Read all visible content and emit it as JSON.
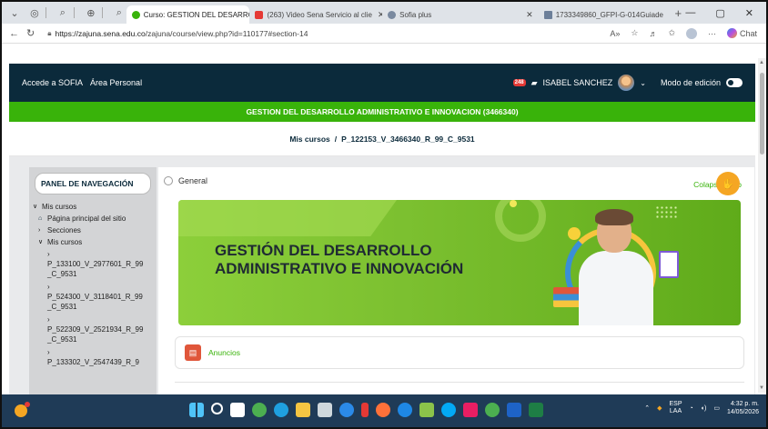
{
  "browser": {
    "tabs": [
      {
        "label": "Curso: GESTION DEL DESARROLL",
        "favicon_color": "#39b30a",
        "active": true
      },
      {
        "label": "(263) Video Sena Servicio al clie",
        "favicon_color": "#e53935",
        "active": false
      },
      {
        "label": "Sofia plus",
        "favicon_color": "#7a8aa0",
        "active": false
      },
      {
        "label": "1733349860_GFPI-G-014Guiade",
        "favicon_color": "#6c7f99",
        "active": false
      }
    ],
    "url_host": "https://zajuna.sena.edu.co",
    "url_path": "/zajuna/course/view.php?id=110177#section-14",
    "chat_label": "Chat"
  },
  "header": {
    "link_sofia": "Accede a SOFIA",
    "link_personal": "Área Personal",
    "notif_count": "248",
    "user_name": "ISABEL SANCHEZ",
    "edit_mode_label": "Modo de edición"
  },
  "course_title": "GESTION DEL DESARROLLO ADMINISTRATIVO E INNOVACION (3466340)",
  "breadcrumb": {
    "root": "Mis cursos",
    "sep": "/",
    "current": "P_122153_V_3466340_R_99_C_9531"
  },
  "sidebar": {
    "title": "PANEL DE NAVEGACIÓN",
    "items": [
      {
        "label": "Mis cursos",
        "level": 0,
        "chev": "v"
      },
      {
        "label": "Página principal del sitio",
        "level": 1,
        "chev": "home"
      },
      {
        "label": "Secciones",
        "level": 1,
        "chev": ">"
      },
      {
        "label": "Mis cursos",
        "level": 1,
        "chev": "v"
      },
      {
        "label": "P_133100_V_2977601_R_99_C_9531",
        "level": 2,
        "chev": ">"
      },
      {
        "label": "P_524300_V_3118401_R_99_C_9531",
        "level": 2,
        "chev": ">"
      },
      {
        "label": "P_522309_V_2521934_R_99_C_9531",
        "level": 2,
        "chev": ">"
      },
      {
        "label": "P_133302_V_2547439_R_9",
        "level": 2,
        "chev": ">"
      }
    ]
  },
  "main": {
    "section_label": "General",
    "collapse_label": "Colapsar todo",
    "banner_line1": "GESTIÓN DEL DESARROLLO",
    "banner_line2": "ADMINISTRATIVO E INNOVACIÓN",
    "announcements_label": "Anuncios"
  },
  "taskbar": {
    "lang_top": "ESP",
    "lang_bottom": "LAA",
    "time": "4:32 p. m.",
    "date": "14/05/2026"
  },
  "colors": {
    "header_dark": "#0b2a3b",
    "accent_green": "#39b30a",
    "help_orange": "#f5a623"
  }
}
